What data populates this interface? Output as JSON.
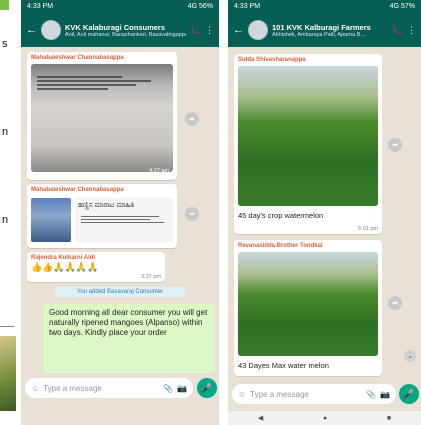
{
  "left_fragment": {
    "letters": [
      "s",
      "n",
      "n"
    ]
  },
  "phone1": {
    "status": {
      "time": "4:33 PM",
      "right": "4G 56%"
    },
    "header": {
      "title": "KVK Kalaburagi Consumers",
      "subtitle": "Anil, Anil mahanur, Banashankari, Basavalingappa…"
    },
    "msg1": {
      "sender": "Mahabaleshwar Channabasappa",
      "time": "4:27 am"
    },
    "msg2": {
      "sender": "Mahabaleshwar Channabasappa",
      "caption": "ಹಣ್ಣಿನ ಮಾರಾಟ ಮಾಹಿತಿ"
    },
    "msg3": {
      "sender": "Rajendra Kulkarni Aldi",
      "emojis": "👍👍🙏🙏🙏🙏",
      "time": "3:37 pm"
    },
    "system": "You added Basavaraj Consumer",
    "outgoing": "Good morning all dear consumer you will get naturally ripened mangoes (Alpanso) within two days. Kindly place your order",
    "input_placeholder": "Type a message"
  },
  "phone2": {
    "status": {
      "time": "4:33 PM",
      "right": "4G 57%"
    },
    "header": {
      "title": "101 KVK Kalburagi Farmers",
      "subtitle": "Abhishek, Ambaraya Patil, Aparna B…"
    },
    "msg1": {
      "sender": "Sidda Shivasharanappa",
      "caption": "45 day's crop watermelon",
      "time": "5:01 pm"
    },
    "msg2": {
      "sender": "Revanasidda Brother Tondkal",
      "caption": "43 Dayes Max water melon"
    },
    "input_placeholder": "Type a message"
  },
  "colors": {
    "header": "#075e54",
    "outgoing": "#dcf8c6",
    "chat_bg": "#e9e1d6",
    "accent": "#00a884"
  }
}
